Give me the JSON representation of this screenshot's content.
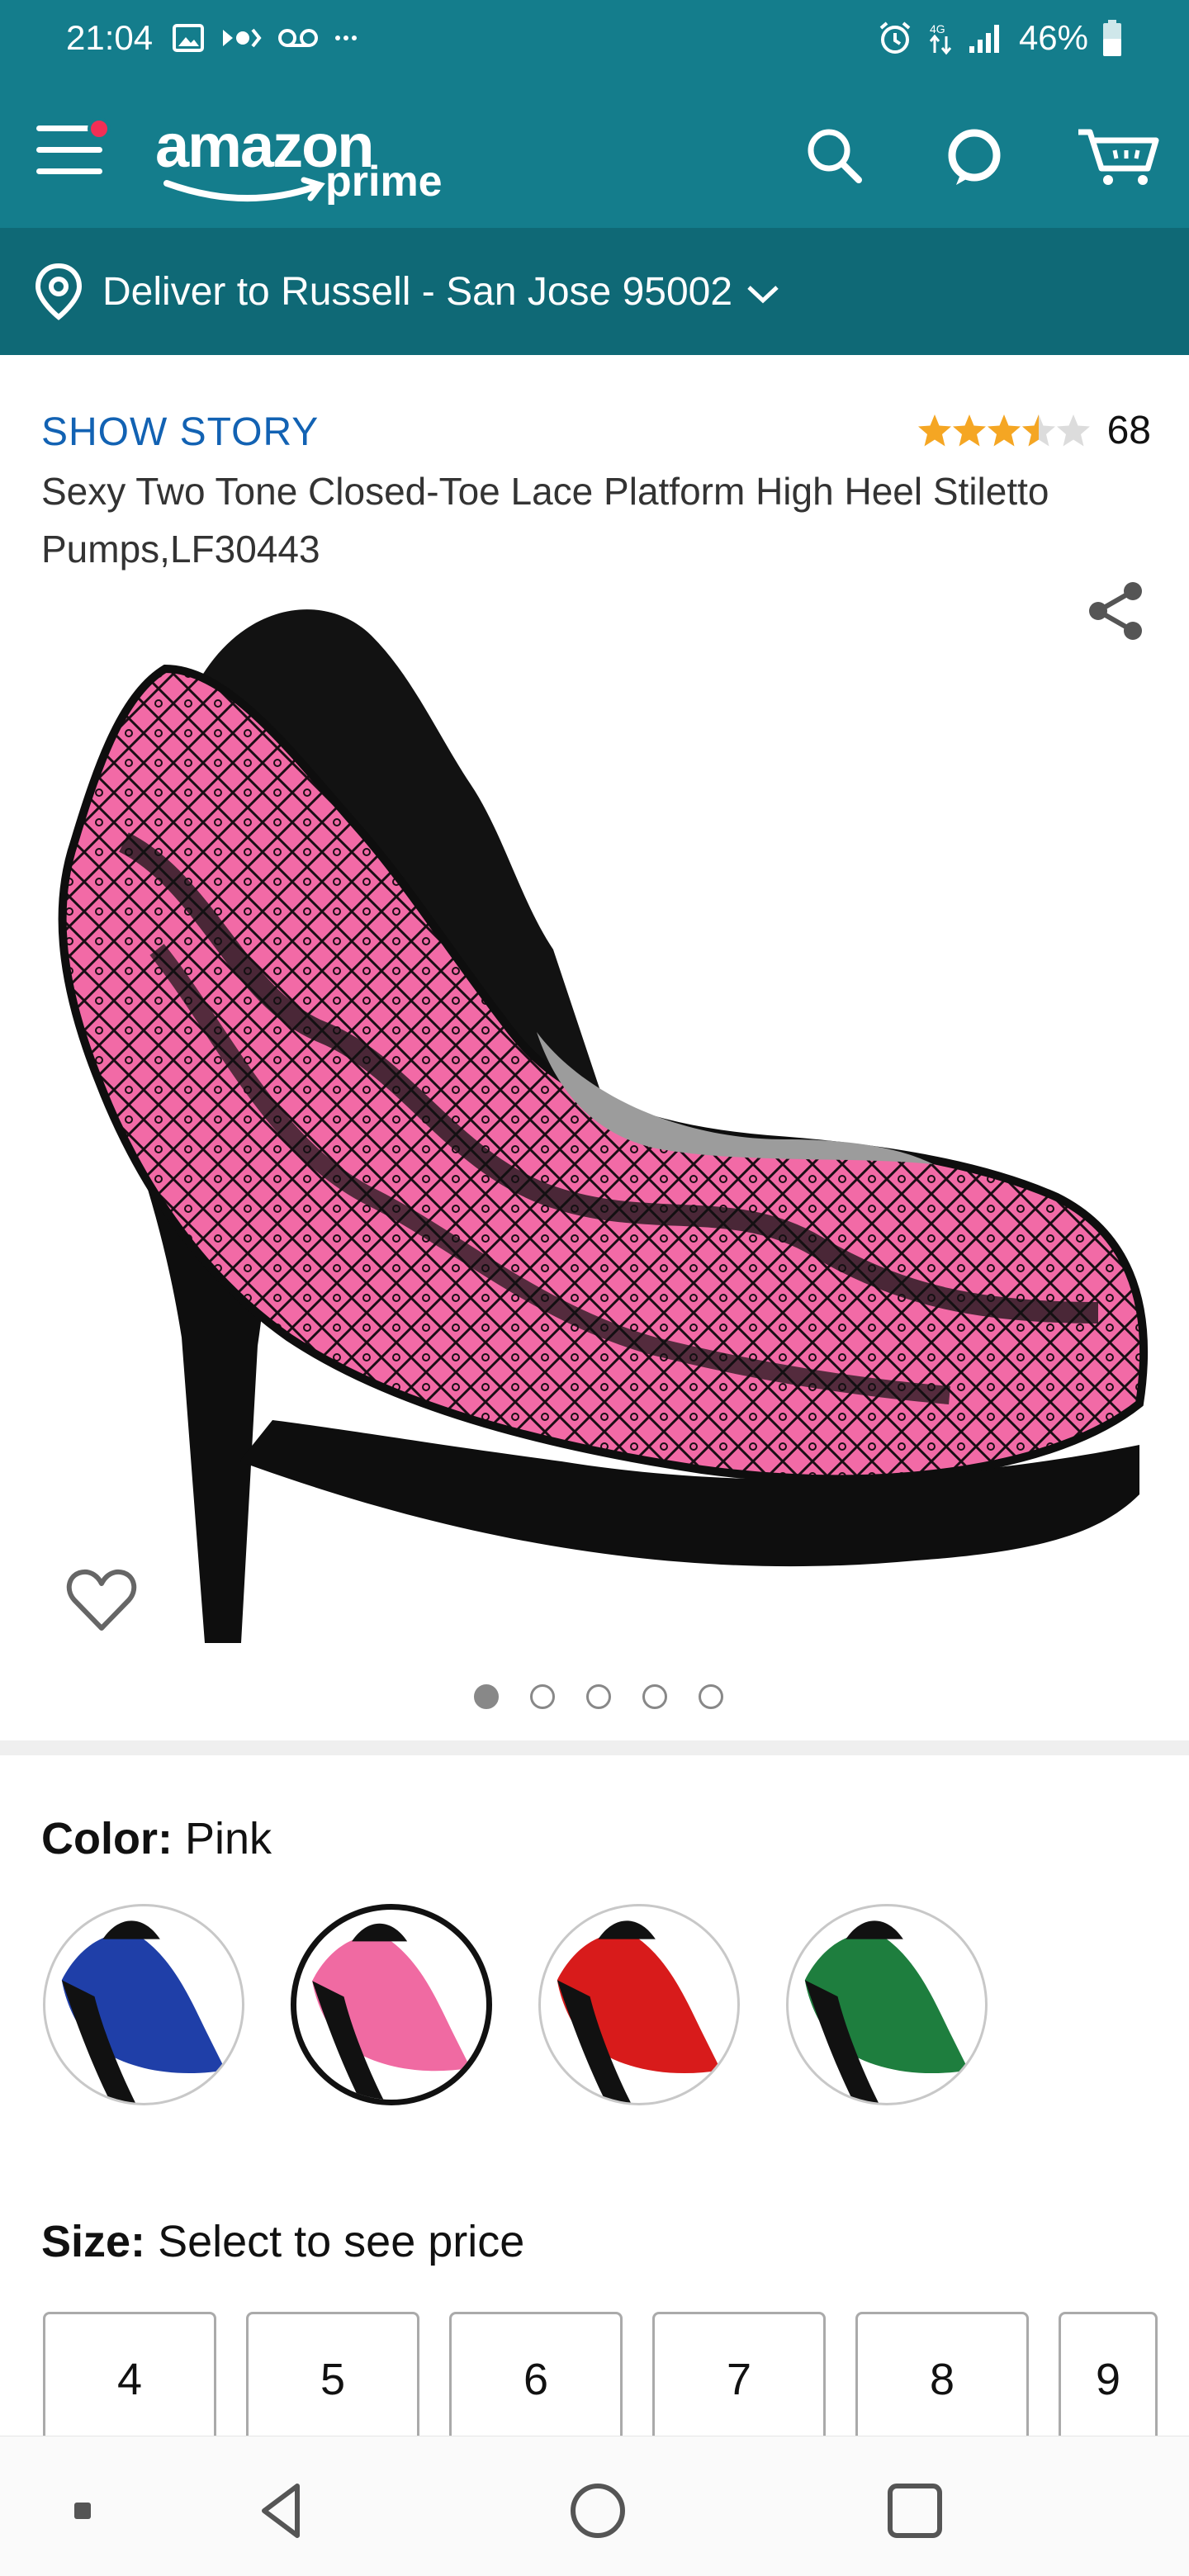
{
  "status_bar": {
    "time": "21:04",
    "battery": "46%",
    "icons": [
      "image-icon",
      "signal-play-icon",
      "voicemail-icon",
      "more-dots-icon",
      "alarm-icon",
      "data-arrows-icon",
      "cell-signal-icon",
      "battery-icon"
    ]
  },
  "header": {
    "logo_main": "amazon",
    "logo_sub": "prime",
    "icons": [
      "hamburger-menu-icon",
      "search-icon",
      "alexa-icon",
      "cart-icon"
    ]
  },
  "delivery": {
    "text": "Deliver to Russell - San Jose 95002"
  },
  "product": {
    "show_story": "SHOW STORY",
    "rating_count": "68",
    "rating_value": 3.5,
    "title": "Sexy Two Tone Closed-Toe Lace Platform High Heel Stiletto Pumps,LF30443",
    "image_count": 5,
    "active_image": 1
  },
  "color": {
    "label": "Color:",
    "value": "Pink",
    "swatches": [
      {
        "name": "Blue",
        "accent": "#1f3fa8"
      },
      {
        "name": "Pink",
        "accent": "#f06aa2"
      },
      {
        "name": "Red",
        "accent": "#d81b1b"
      },
      {
        "name": "Green",
        "accent": "#1e7e3e"
      }
    ],
    "selected": "Pink"
  },
  "size": {
    "label": "Size:",
    "value": "Select to see price",
    "options": [
      "4",
      "5",
      "6",
      "7",
      "8",
      "9"
    ]
  },
  "colors": {
    "header_teal": "#147d8c",
    "delivery_teal": "#0f6976",
    "link_blue": "#1262b3",
    "star_gold": "#f5a623"
  }
}
